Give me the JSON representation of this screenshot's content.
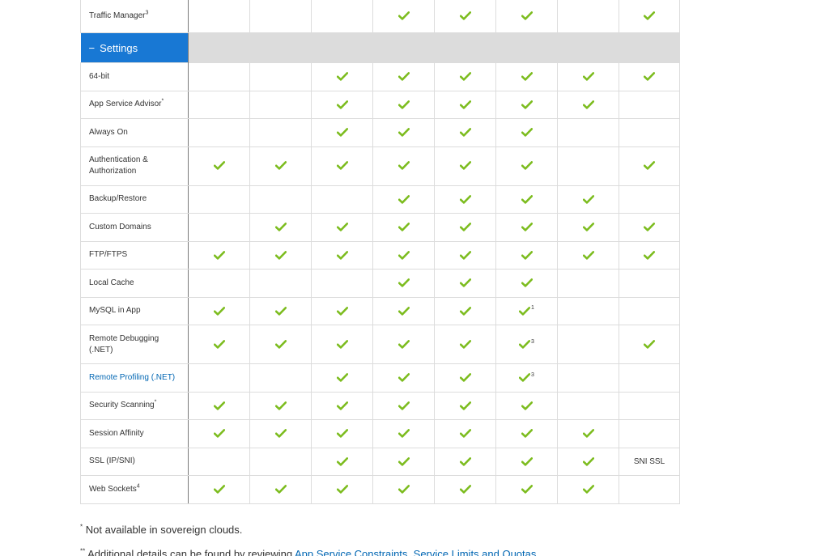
{
  "colors": {
    "section_header": "#1878d4",
    "section_fill": "#dcdcdc",
    "check": "#7cbc1e",
    "link": "#0066b3"
  },
  "top_row": {
    "label": "Traffic Manager",
    "label_note": "3",
    "cells": [
      "",
      "",
      "",
      "check",
      "check",
      "check",
      "",
      "check"
    ]
  },
  "section": {
    "icon": "minus-icon",
    "title": "Settings"
  },
  "rows": [
    {
      "label": "64-bit",
      "label_note": "",
      "cells": [
        "",
        "",
        "check",
        "check",
        "check",
        "check",
        "check",
        "check"
      ]
    },
    {
      "label": "App Service Advisor",
      "label_note": "*",
      "cells": [
        "",
        "",
        "check",
        "check",
        "check",
        "check",
        "check",
        ""
      ]
    },
    {
      "label": "Always On",
      "label_note": "",
      "cells": [
        "",
        "",
        "check",
        "check",
        "check",
        "check",
        "",
        ""
      ]
    },
    {
      "label": "Authentication & Authorization",
      "label_note": "",
      "cells": [
        "check",
        "check",
        "check",
        "check",
        "check",
        "check",
        "",
        "check"
      ]
    },
    {
      "label": "Backup/Restore",
      "label_note": "",
      "cells": [
        "",
        "",
        "",
        "check",
        "check",
        "check",
        "check",
        ""
      ]
    },
    {
      "label": "Custom Domains",
      "label_note": "",
      "cells": [
        "",
        "check",
        "check",
        "check",
        "check",
        "check",
        "check",
        "check"
      ]
    },
    {
      "label": "FTP/FTPS",
      "label_note": "",
      "cells": [
        "check",
        "check",
        "check",
        "check",
        "check",
        "check",
        "check",
        "check"
      ]
    },
    {
      "label": "Local Cache",
      "label_note": "",
      "cells": [
        "",
        "",
        "",
        "check",
        "check",
        "check",
        "",
        ""
      ]
    },
    {
      "label": "MySQL in App",
      "label_note": "",
      "cells": [
        "check",
        "check",
        "check",
        "check",
        "check",
        "check|1",
        "",
        ""
      ]
    },
    {
      "label": "Remote Debugging (.NET)",
      "label_note": "",
      "cells": [
        "check",
        "check",
        "check",
        "check",
        "check",
        "check|3",
        "",
        "check"
      ]
    },
    {
      "label": "Remote Profiling (.NET)",
      "label_note": "",
      "link": true,
      "cells": [
        "",
        "",
        "check",
        "check",
        "check",
        "check|3",
        "",
        ""
      ]
    },
    {
      "label": "Security Scanning",
      "label_note": "*",
      "cells": [
        "check",
        "check",
        "check",
        "check",
        "check",
        "check",
        "",
        ""
      ]
    },
    {
      "label": "Session Affinity",
      "label_note": "",
      "cells": [
        "check",
        "check",
        "check",
        "check",
        "check",
        "check",
        "check",
        ""
      ]
    },
    {
      "label": "SSL (IP/SNI)",
      "label_note": "",
      "cells": [
        "",
        "",
        "check",
        "check",
        "check",
        "check",
        "check",
        "text:SNI SSL"
      ]
    },
    {
      "label": "Web Sockets",
      "label_note": "4",
      "cells": [
        "check",
        "check",
        "check",
        "check",
        "check",
        "check",
        "check",
        ""
      ]
    }
  ],
  "footnotes": {
    "first": {
      "mark": "*",
      "text": " Not available in sovereign clouds."
    },
    "second": {
      "mark": "**",
      "text": " Additional details can be found by reviewing ",
      "link": "App Service Constraints, Service Limits and Quotas"
    }
  }
}
